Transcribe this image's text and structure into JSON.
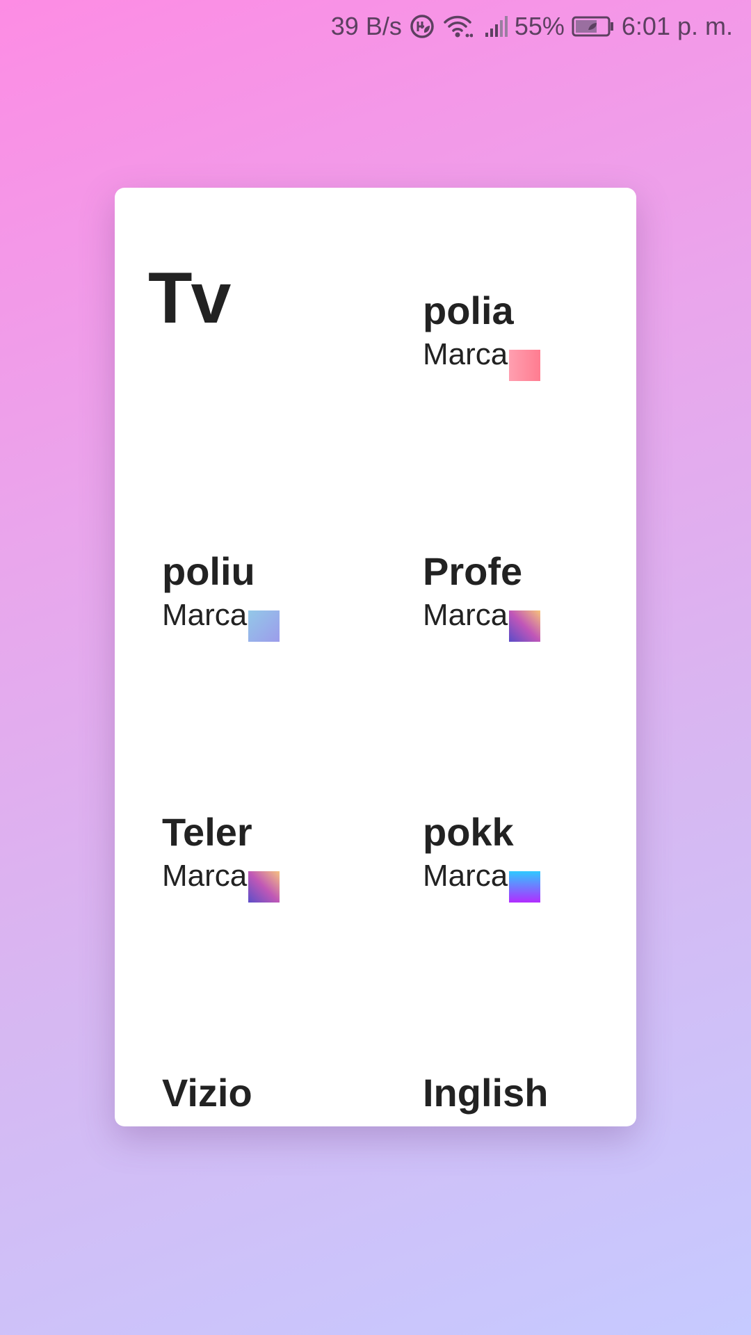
{
  "status_bar": {
    "net_speed": "39 B/s",
    "battery_percent": "55%",
    "time": "6:01 p. m.",
    "icons": [
      "data-saver-icon",
      "wifi-icon",
      "cell-signal-icon",
      "battery-icon"
    ]
  },
  "card": {
    "title": "Tv",
    "tiles": [
      {
        "name": "polia",
        "brand": "Marca",
        "swatch_from": "#ff8fa2",
        "swatch_to": "#ff7d8f"
      },
      {
        "name": "poliu",
        "brand": "Marca",
        "swatch_from": "#93c4e9",
        "swatch_to": "#9aa0ea"
      },
      {
        "name": "Profe",
        "brand": "Marca",
        "swatch_from": "#f7c27a",
        "swatch_to": "#6a4fc9"
      },
      {
        "name": "Teler",
        "brand": "Marca",
        "swatch_from": "#f6c280",
        "swatch_to": "#6a4fc9"
      },
      {
        "name": "pokk",
        "brand": "Marca",
        "swatch_from": "#2ec8ff",
        "swatch_to": "#b22cff"
      },
      {
        "name": "Vizio",
        "brand": "",
        "swatch_from": "",
        "swatch_to": ""
      },
      {
        "name": "Inglish",
        "brand": "",
        "swatch_from": "",
        "swatch_to": ""
      }
    ]
  }
}
